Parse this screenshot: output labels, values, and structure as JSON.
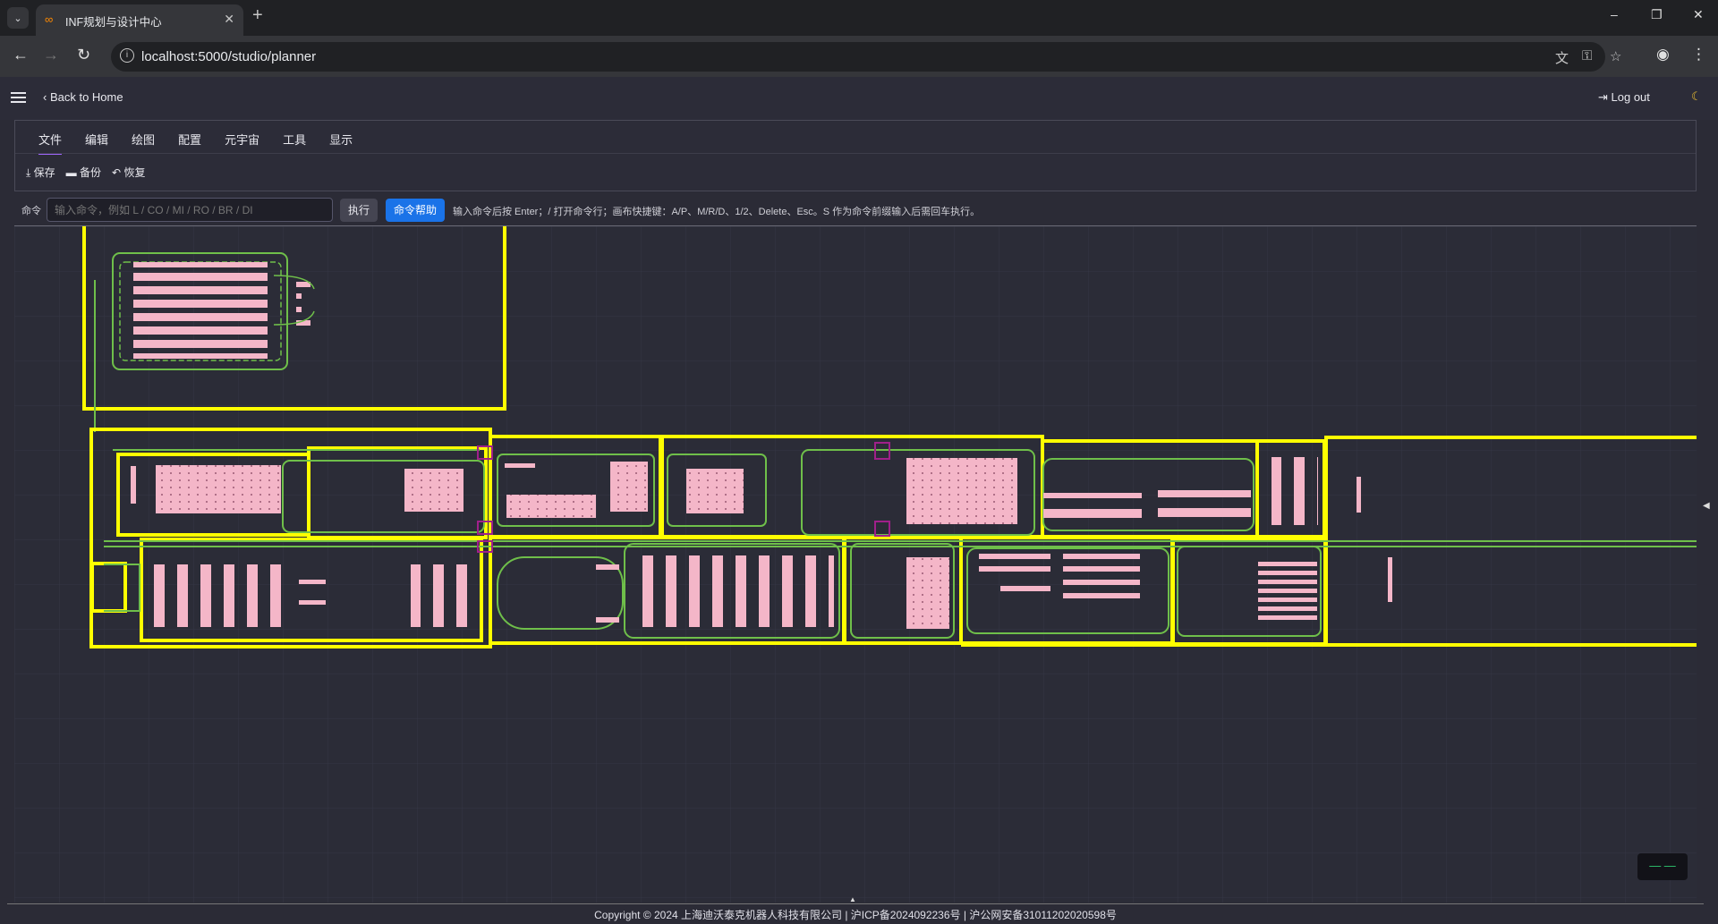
{
  "browser": {
    "tab_title": "INF规划与设计中心",
    "tab_close": "✕",
    "new_tab": "+",
    "url": "localhost:5000/studio/planner",
    "window_controls": [
      "–",
      "❐",
      "✕"
    ]
  },
  "header": {
    "back_label": "Back to Home",
    "logout_label": "Log out"
  },
  "menu": {
    "tabs": [
      "文件",
      "编辑",
      "绘图",
      "配置",
      "元宇宙",
      "工具",
      "显示"
    ],
    "active_tab": "文件"
  },
  "file_actions": {
    "save": "保存",
    "backup": "备份",
    "restore": "恢复"
  },
  "command": {
    "label": "命令",
    "placeholder": "输入命令，例如 L / CO / MI / RO / BR / DI",
    "execute": "执行",
    "help": "命令帮助",
    "hint": "输入命令后按 Enter；/ 打开命令行；画布快捷键：A/P、M/R/D、1/2、Delete、Esc。S 作为命令前缀输入后需回车执行。"
  },
  "canvas": {
    "mini_button": "—  —",
    "colors": {
      "frame": "#ffff00",
      "path": "#6fbf4a",
      "shelf": "#f4b6c8",
      "background": "#2b2c37"
    }
  },
  "footer": {
    "copyright": "Copyright © 2024 上海迪沃泰克机器人科技有限公司 | 沪ICP备2024092236号 | 沪公网安备31011202020598号"
  }
}
